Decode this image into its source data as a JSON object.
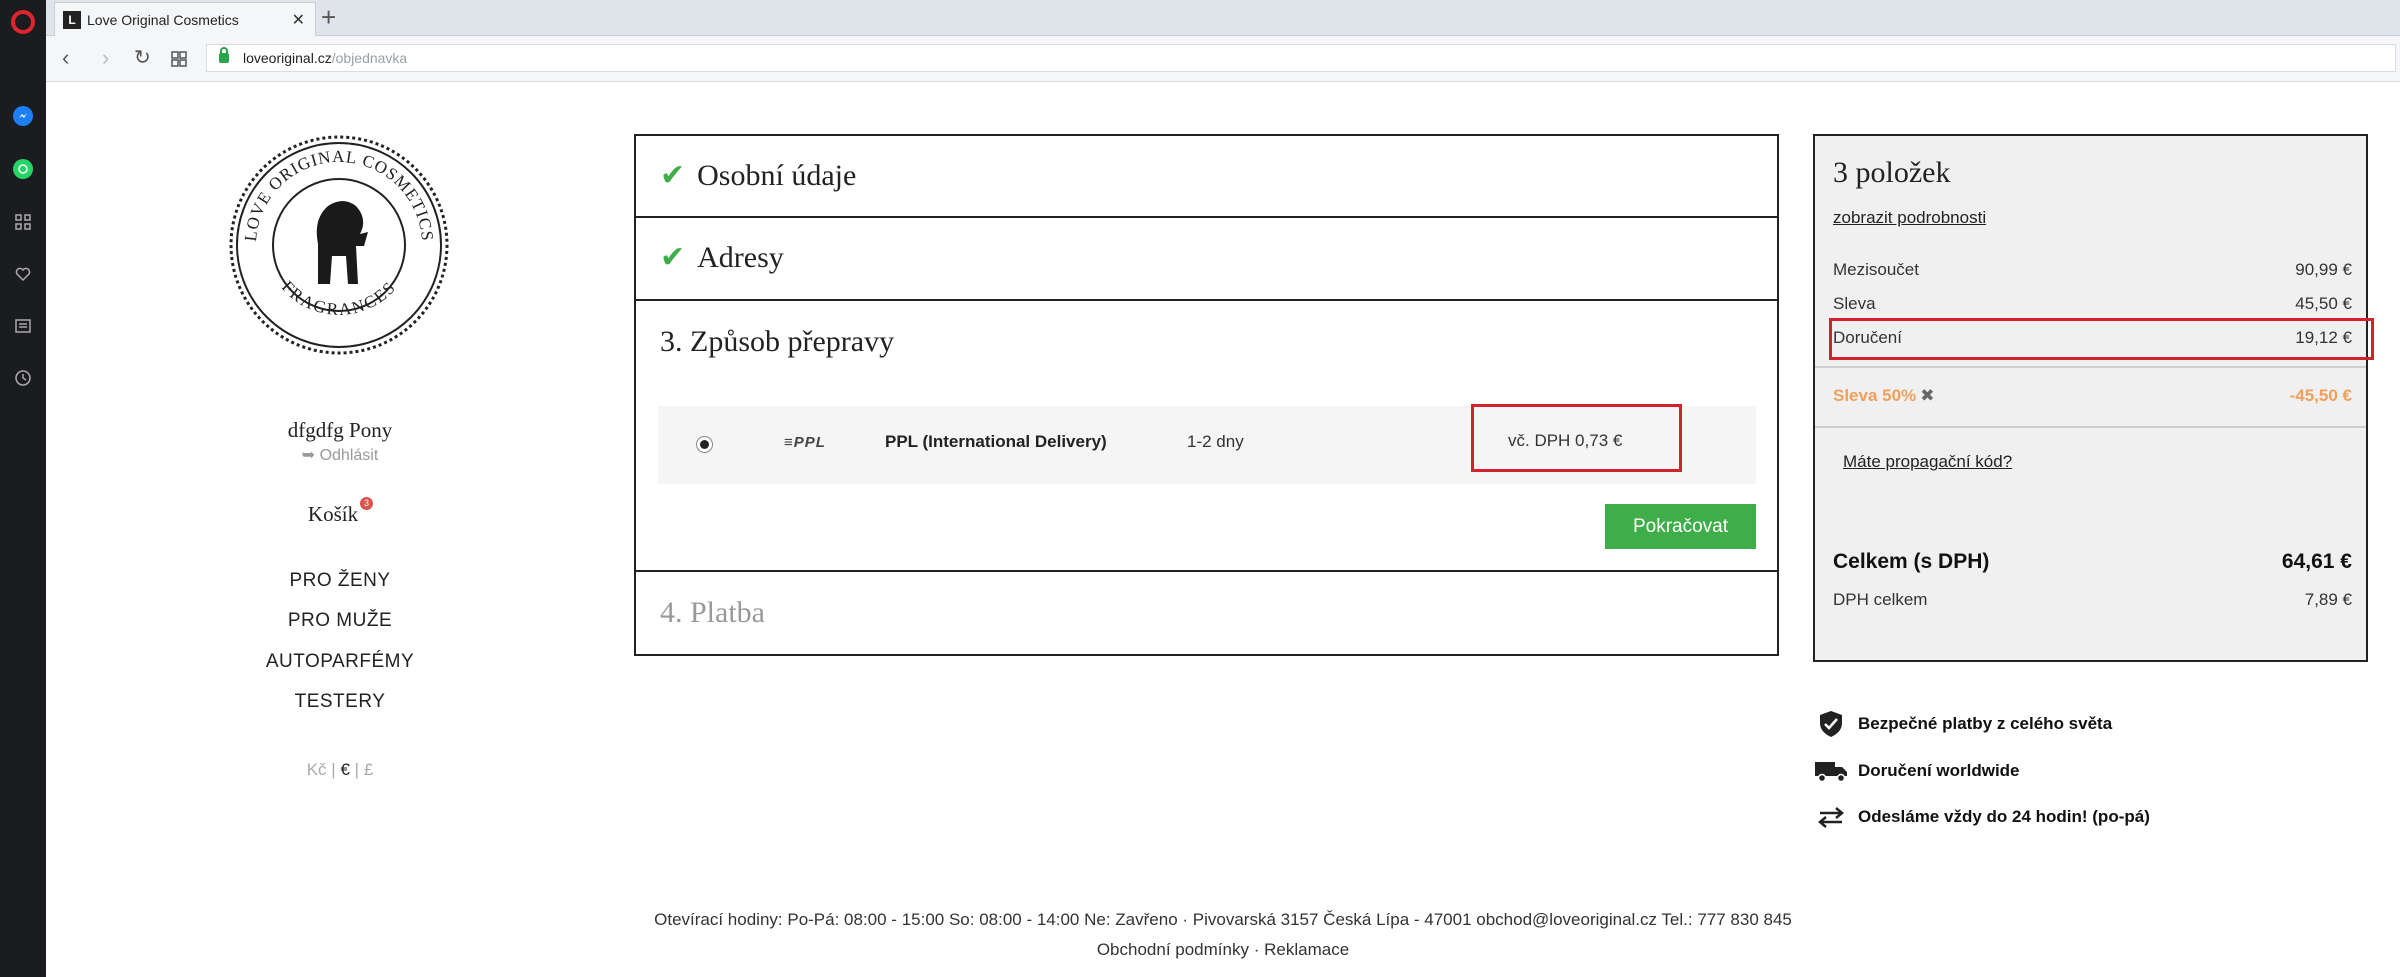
{
  "browser": {
    "tab_title": "Love Original Cosmetics",
    "tab_favicon_letter": "L",
    "url_host": "loveoriginal.cz",
    "url_path": "/objednavka"
  },
  "logo": {
    "text_top": "LOVE ORIGINAL COSMETICS",
    "text_bottom": "FRAGRANCES"
  },
  "user": {
    "name": "dfgdfg Pony",
    "logout_label": "Odhlásit"
  },
  "cart": {
    "label": "Košík",
    "count": "3"
  },
  "menu": [
    "PRO ŽENY",
    "PRO MUŽE",
    "AUTOPARFÉMY",
    "TESTERY"
  ],
  "currency": {
    "czk": "Kč",
    "eur": "€",
    "gbp": "£",
    "separator": "|"
  },
  "steps": {
    "step1": "Osobní údaje",
    "step2": "Adresy",
    "step3": "3. Způsob přepravy",
    "step4": "4. Platba",
    "delivery": {
      "logo": "≡PPL",
      "carrier": "PPL (International Delivery)",
      "days": "1-2 dny",
      "price": "vč. DPH 0,73 €"
    },
    "continue_label": "Pokračovat"
  },
  "summary": {
    "title": "3 položek",
    "details_link": "zobrazit podrobnosti",
    "subtotal_label": "Mezisoučet",
    "subtotal_value": "90,99 €",
    "discount_label": "Sleva",
    "discount_value": "45,50 €",
    "delivery_label": "Doručení",
    "delivery_value": "19,12 €",
    "coupon_label": "Sleva 50%",
    "coupon_value": "-45,50 €",
    "promo_link": "Máte propagační kód?",
    "total_label": "Celkem (s DPH)",
    "total_value": "64,61 €",
    "vat_label": "DPH celkem",
    "vat_value": "7,89 €"
  },
  "features": [
    "Bezpečné platby z celého světa",
    "Doručení worldwide",
    "Odesláme vždy do 24 hodin! (po-pá)"
  ],
  "footer": {
    "line1": "Otevírací hodiny: Po-Pá: 08:00 - 15:00 So: 08:00 - 14:00 Ne: Zavřeno · Pivovarská 3157 Česká Lípa - 47001 obchod@loveoriginal.cz Tel.: 777 830 845",
    "terms": "Obchodní podmínky",
    "dot": "·",
    "complaints": "Reklamace"
  },
  "colors": {
    "accent_green": "#3fae49",
    "highlight_red": "#d3222e",
    "discount_orange": "#f0a05a"
  }
}
